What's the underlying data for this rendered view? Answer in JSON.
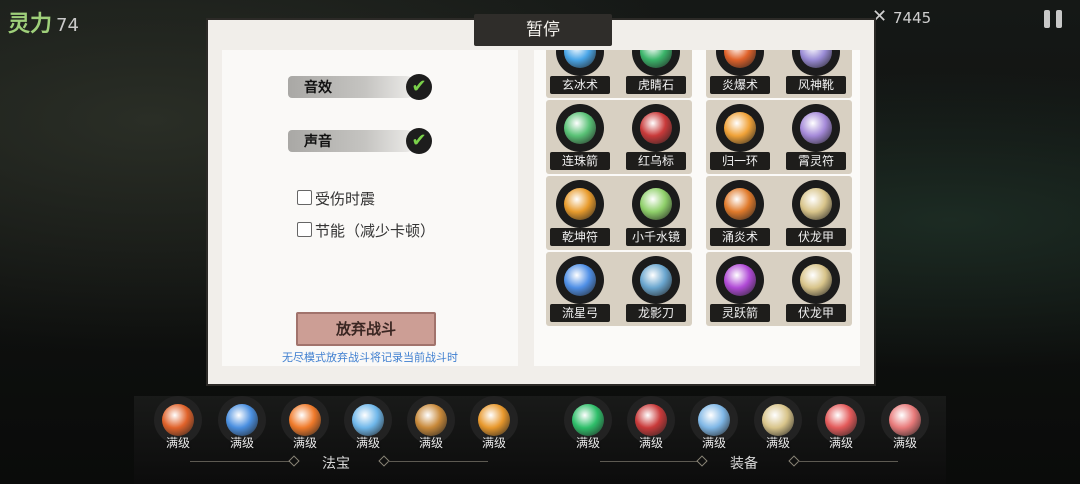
{
  "hud": {
    "spirit_label": "灵力",
    "spirit_value": "74",
    "top_score": "7445"
  },
  "dialog": {
    "title": "暂停",
    "settings": {
      "sound_effects": {
        "label": "音效",
        "checked": true
      },
      "voice": {
        "label": "声音",
        "checked": true
      },
      "shake_on_hit": {
        "label": "受伤时震",
        "checked": false
      },
      "power_saving": {
        "label": "节能（减少卡顿）",
        "checked": false
      }
    },
    "abandon_label": "放弃战斗",
    "hint": "无尽模式放弃战斗将记录当前战斗时",
    "items": [
      {
        "name": "玄冰术",
        "color": "#4aa6e8"
      },
      {
        "name": "虎睛石",
        "color": "#3bb56a"
      },
      {
        "name": "炎爆术",
        "color": "#e0622a"
      },
      {
        "name": "风神靴",
        "color": "#9a8cd6"
      },
      {
        "name": "连珠箭",
        "color": "#59c276"
      },
      {
        "name": "红乌标",
        "color": "#c93a3a"
      },
      {
        "name": "归一环",
        "color": "#f0a238"
      },
      {
        "name": "霄灵符",
        "color": "#a58ad9"
      },
      {
        "name": "乾坤符",
        "color": "#e89b2c"
      },
      {
        "name": "小千水镜",
        "color": "#8fd06a"
      },
      {
        "name": "涌炎术",
        "color": "#e07a2b"
      },
      {
        "name": "伏龙甲",
        "color": "#d8c48a"
      },
      {
        "name": "流星弓",
        "color": "#4f8fe6"
      },
      {
        "name": "龙影刀",
        "color": "#6aa6cf"
      },
      {
        "name": "灵跃箭",
        "color": "#b04ad6"
      },
      {
        "name": "伏龙甲",
        "color": "#d8c48a"
      }
    ]
  },
  "bottom": {
    "level_text": "满级",
    "treasure_label": "法宝",
    "equipment_label": "装备",
    "treasures": [
      {
        "color": "#e0622a"
      },
      {
        "color": "#4a8fe0"
      },
      {
        "color": "#f07a2a"
      },
      {
        "color": "#6fb7ea"
      },
      {
        "color": "#c8893a"
      },
      {
        "color": "#e8982c"
      }
    ],
    "equipment": [
      {
        "color": "#2fbf6a"
      },
      {
        "color": "#c93a3a"
      },
      {
        "color": "#7fb7e6"
      },
      {
        "color": "#d8c48a"
      },
      {
        "color": "#e35a5a"
      },
      {
        "color": "#e87a7a"
      }
    ]
  }
}
